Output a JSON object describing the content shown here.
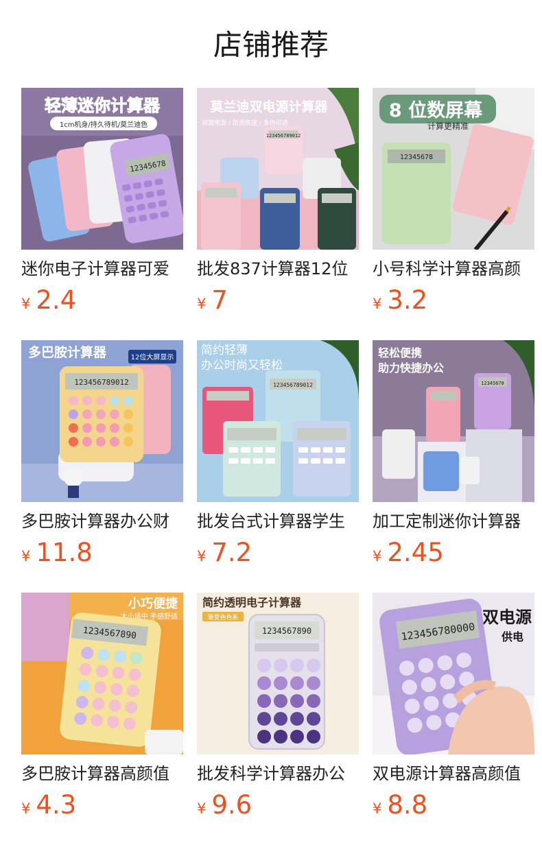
{
  "page": {
    "title": "店铺推荐"
  },
  "colors": {
    "price": "#f0501e",
    "text": "#222222"
  },
  "currency": "¥",
  "products": [
    {
      "name": "迷你电子计算器可爱",
      "price": "2.4",
      "image": {
        "headline": "轻薄迷你计算器",
        "subline": "1cm机身/持久待机/莫兰迪色",
        "lcd": "12345678"
      }
    },
    {
      "name": "批发837计算器12位",
      "price": "7",
      "image": {
        "headline": "莫兰迪双电源计算器",
        "subline": "双面电源 / 防滑底座 / 多色可选",
        "lcd": "123456789012"
      }
    },
    {
      "name": "小号科学计算器高颜",
      "price": "3.2",
      "image": {
        "headline": "8 位数屏幕",
        "subline": "计算更精准",
        "lcd": "12345678"
      }
    },
    {
      "name": "多巴胺计算器办公财",
      "price": "11.8",
      "image": {
        "headline": "多巴胺计算器",
        "badge": "12位大屏显示",
        "lcd": "123456789012"
      }
    },
    {
      "name": "批发台式计算器学生",
      "price": "7.2",
      "image": {
        "headline": "简约轻薄",
        "subline": "办公时尚又轻松",
        "lcd": "123456789012"
      }
    },
    {
      "name": "加工定制迷你计算器",
      "price": "2.45",
      "image": {
        "headline": "轻松便携",
        "subline": "助力快捷办公",
        "lcd": "12345678"
      }
    },
    {
      "name": "多巴胺计算器高颜值",
      "price": "4.3",
      "image": {
        "headline": "小巧便捷",
        "subline": "大小适中 手感舒适",
        "lcd": "1234567890"
      }
    },
    {
      "name": "批发科学计算器办公",
      "price": "9.6",
      "image": {
        "headline": "简约透明电子计算器",
        "badge": "渐变色色系",
        "lcd": "1234567890"
      }
    },
    {
      "name": "双电源计算器高颜值",
      "price": "8.8",
      "image": {
        "headline": "双电源",
        "subline": "供电",
        "lcd": "123456780000"
      }
    }
  ]
}
